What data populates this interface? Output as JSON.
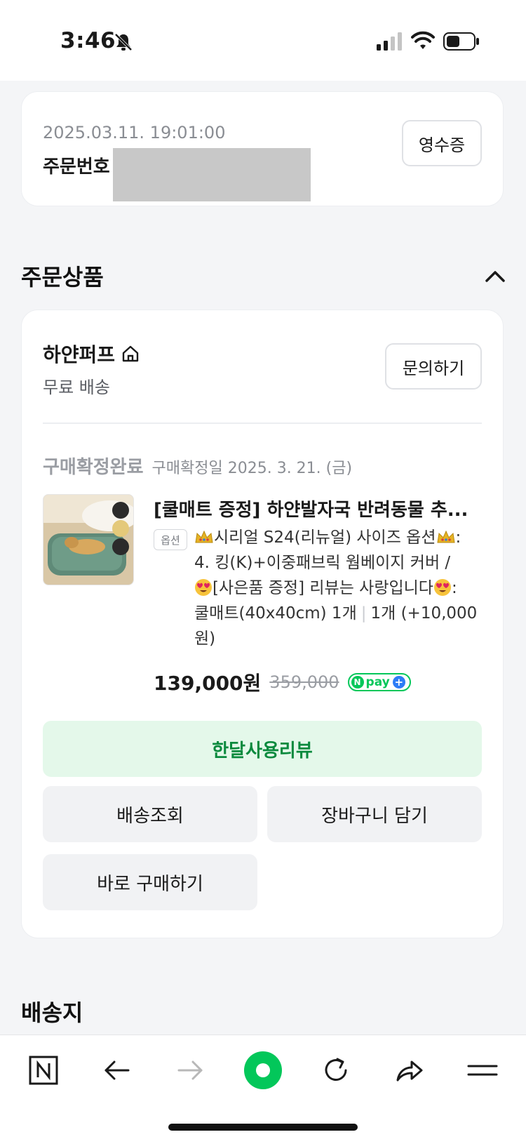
{
  "status_bar": {
    "time": "3:46"
  },
  "order": {
    "date": "2025.03.11. 19:01:00",
    "number_label": "주문번호",
    "receipt_button": "영수증"
  },
  "sections": {
    "ordered_products": "주문상품",
    "shipping_address": "배송지"
  },
  "seller": {
    "name": "하얀퍼프",
    "shipping": "무료 배송",
    "inquire_button": "문의하기"
  },
  "item": {
    "status": "구매확정완료",
    "confirmed_date": "구매확정일 2025. 3. 21. (금)",
    "title": "[쿨매트 증정] 하얀발자국 반려동물 추...",
    "option_badge": "옵션",
    "option_line1": "시리얼 S24(리뉴얼) 사이즈 옵션",
    "option_line1_tail": ":",
    "option_line2": "4. 킹(K)+이중패브릭 웜베이지 커버 /",
    "option_line3": "[사은품 증정] 리뷰는 사랑입니다",
    "option_line3_tail": ":",
    "option_line4": "쿨매트(40x40cm) 1개",
    "quantity": "1개 (+10,000",
    "quantity_tail": "원)",
    "price": "139,000원",
    "original_price": "359,000",
    "npay_label": "pay"
  },
  "actions": {
    "review": "한달사용리뷰",
    "track": "배송조회",
    "add_to_cart": "장바구니 담기",
    "buy_now": "바로 구매하기"
  },
  "toolbar": {
    "icons": [
      "naver-n-icon",
      "back-arrow-icon",
      "forward-arrow-icon",
      "green-home-icon",
      "refresh-icon",
      "share-icon",
      "menu-icon"
    ]
  },
  "colors": {
    "accent_green": "#03c75a",
    "review_bg": "#e4f8ea",
    "review_text": "#0b8a3e"
  }
}
